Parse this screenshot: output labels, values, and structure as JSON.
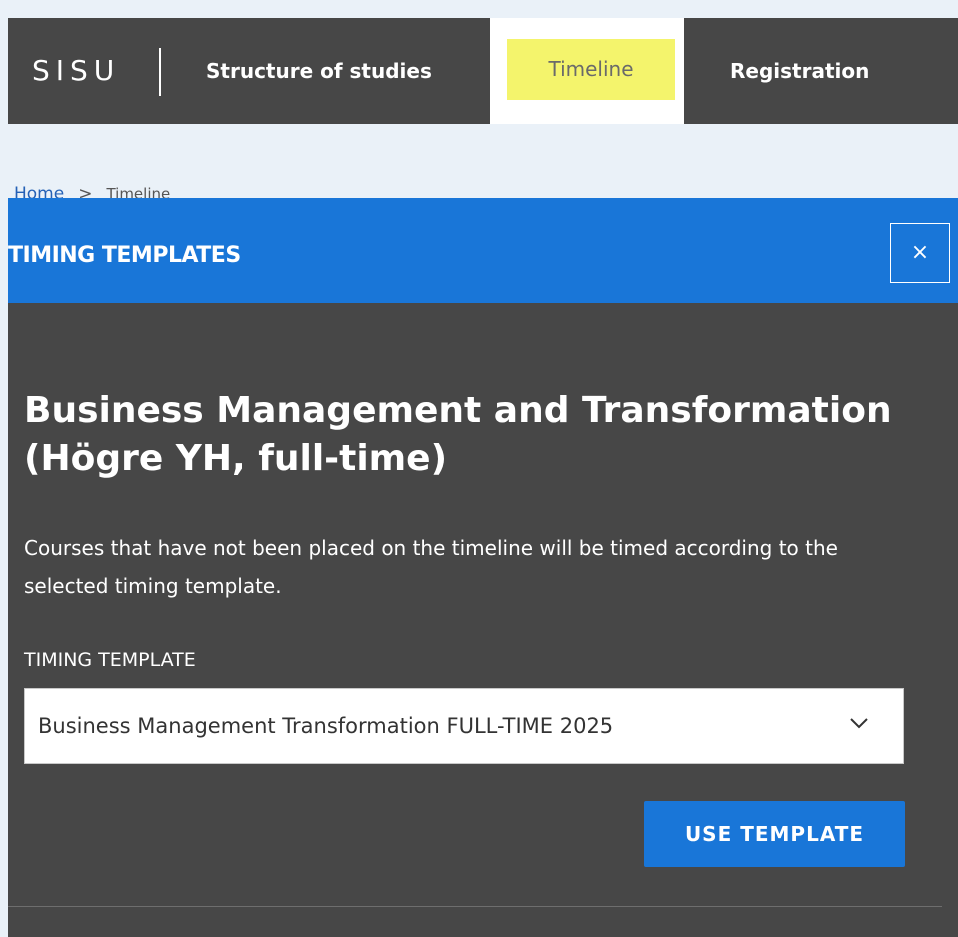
{
  "topbar": {
    "logo": "SISU",
    "nav": {
      "structure": "Structure of studies",
      "timeline": "Timeline",
      "registration": "Registration"
    }
  },
  "breadcrumb": {
    "home": "Home",
    "separator": ">",
    "current": "Timeline"
  },
  "modal": {
    "header_title": "TIMING TEMPLATES",
    "close_icon": "×",
    "programme_title": "Business Management and Transformation (Högre YH, full-time)",
    "description": "Courses that have not been placed on the timeline will be timed according to the selected timing template.",
    "template_label": "TIMING TEMPLATE",
    "template_selected": "Business Management Transformation FULL-TIME 2025",
    "use_button": "USE TEMPLATE"
  },
  "colors": {
    "topbar_bg": "#474747",
    "active_highlight": "#f4f46c",
    "accent_blue": "#1976d8",
    "modal_bg": "#474747"
  },
  "icons": {
    "close": "close-icon",
    "select_chevron": "chevron-down-icon"
  }
}
